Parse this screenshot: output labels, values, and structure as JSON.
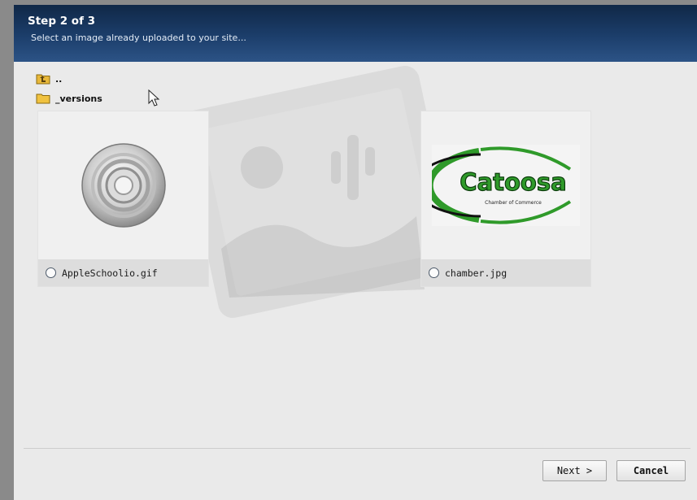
{
  "header": {
    "title": "Step 2 of 3",
    "subtitle": "Select an image already uploaded to your site..."
  },
  "folders": [
    {
      "label": "..",
      "icon": "folder-up-icon"
    },
    {
      "label": "_versions",
      "icon": "folder-icon"
    }
  ],
  "images": [
    {
      "filename": "AppleSchoolio.gif",
      "thumbnail": "cd-disc-icon",
      "selected": false
    },
    {
      "filename": "chamber.jpg",
      "thumbnail": "catoosa-logo",
      "selected": false
    }
  ],
  "logo": {
    "name": "Catoosa",
    "tagline": "Chamber of Commerce"
  },
  "buttons": {
    "next": "Next >",
    "cancel": "Cancel"
  },
  "colors": {
    "header_top": "#102847",
    "header_bottom": "#2c5386",
    "logo_green": "#2f9a2a"
  }
}
